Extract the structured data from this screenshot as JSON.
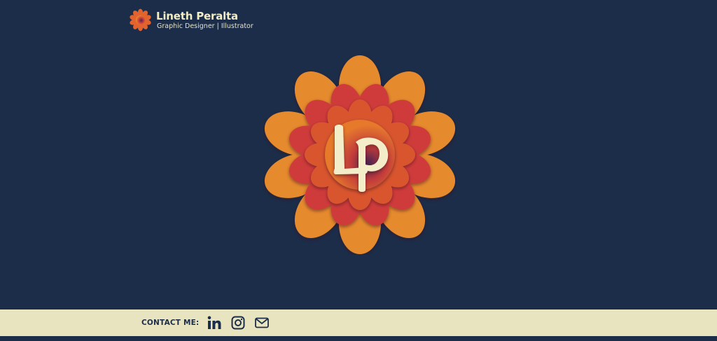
{
  "header": {
    "logo_icon": "flower-logo-icon",
    "name": "Lineth Peralta",
    "tagline": "Graphic Designer | Illustrator"
  },
  "hero": {
    "logo_icon": "flower-lp-monogram-icon",
    "monogram": "LP"
  },
  "footer": {
    "contact_label": "CONTACT ME:",
    "links": [
      {
        "icon": "linkedin-icon"
      },
      {
        "icon": "instagram-icon"
      },
      {
        "icon": "mail-icon"
      }
    ]
  },
  "colors": {
    "background": "#1c2d49",
    "footer_bg": "#e8e4bf",
    "petal_outer": "#e68a2e",
    "petal_middle": "#cf3b3a",
    "text_light": "#f1ecc6"
  }
}
